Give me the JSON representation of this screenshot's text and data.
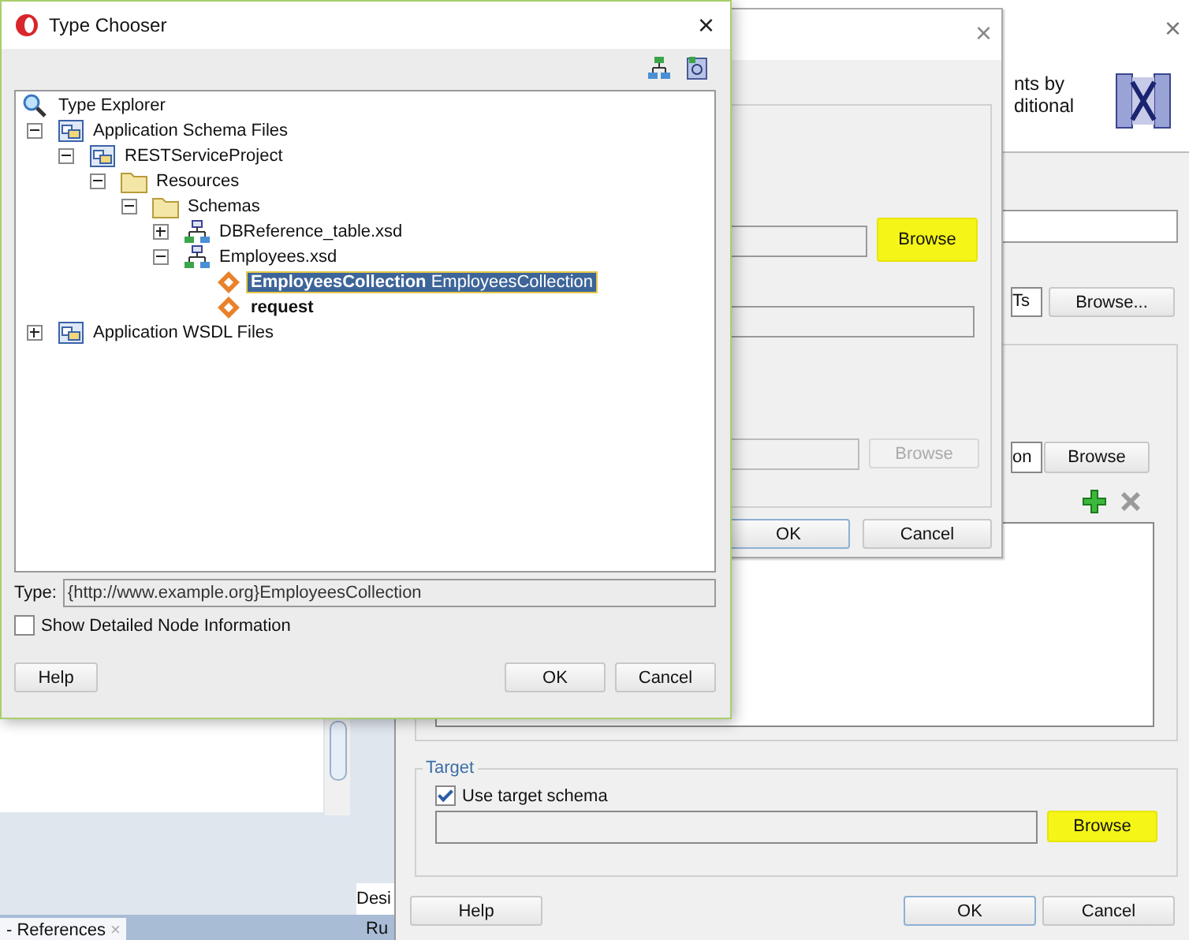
{
  "ide": {
    "tabs": [
      {
        "label": "Desi",
        "selected": true
      },
      {
        "label": "Ru",
        "selected": false
      }
    ],
    "bottom_tab": {
      "label": "- References",
      "close": "×"
    }
  },
  "back_dialog": {
    "close": "×",
    "description": [
      "nts by",
      "ditional"
    ],
    "field_fragment": "Ts",
    "browse_button": {
      "label": "Browse...",
      "highlighted": false
    },
    "option_fragment": "on",
    "browse2_button": {
      "label": "Browse",
      "highlighted": false
    },
    "target": {
      "title": "Target",
      "checkbox": {
        "label": "Use target schema",
        "checked": true
      },
      "browse_button": {
        "label": "Browse",
        "highlighted": true
      }
    },
    "buttons": [
      {
        "label": "Help",
        "kind": "help"
      },
      {
        "label": "OK",
        "kind": "default"
      },
      {
        "label": "Cancel",
        "kind": "normal"
      }
    ]
  },
  "middle_dialog": {
    "close": "×",
    "browse_buttons": [
      {
        "label": "Browse",
        "highlighted": true,
        "disabled": false
      },
      {
        "label": "Browse",
        "highlighted": false,
        "disabled": true
      }
    ],
    "buttons": [
      {
        "label": "OK",
        "kind": "default"
      },
      {
        "label": "Cancel",
        "kind": "normal"
      }
    ]
  },
  "type_chooser": {
    "title": "Type Chooser",
    "close": "×",
    "tree": [
      {
        "label": "Type Explorer",
        "kind": "explorer",
        "children": [
          {
            "label": "Application Schema Files",
            "kind": "project",
            "expanded": true,
            "children": [
              {
                "label": "RESTServiceProject",
                "kind": "project",
                "expanded": true,
                "children": [
                  {
                    "label": "Resources",
                    "kind": "folder",
                    "expanded": true,
                    "children": [
                      {
                        "label": "Schemas",
                        "kind": "folder",
                        "expanded": true,
                        "children": [
                          {
                            "label": "DBReference_table.xsd",
                            "kind": "schema",
                            "expanded": false
                          },
                          {
                            "label": "Employees.xsd",
                            "kind": "schema",
                            "expanded": true,
                            "children": [
                              {
                                "label": "EmployeesCollection",
                                "type": "EmployeesCollection",
                                "kind": "element",
                                "selected": true
                              },
                              {
                                "label": "request",
                                "kind": "element",
                                "selected": false
                              }
                            ]
                          }
                        ]
                      }
                    ]
                  }
                ]
              }
            ]
          },
          {
            "label": "Application WSDL Files",
            "kind": "project",
            "expanded": false
          }
        ]
      }
    ],
    "type_label": "Type:",
    "type_value": "{http://www.example.org}EmployeesCollection",
    "detail_checkbox": {
      "label": "Show Detailed Node Information",
      "checked": false
    },
    "buttons": [
      {
        "label": "Help",
        "kind": "help"
      },
      {
        "label": "OK",
        "kind": "normal"
      },
      {
        "label": "Cancel",
        "kind": "normal"
      }
    ]
  }
}
